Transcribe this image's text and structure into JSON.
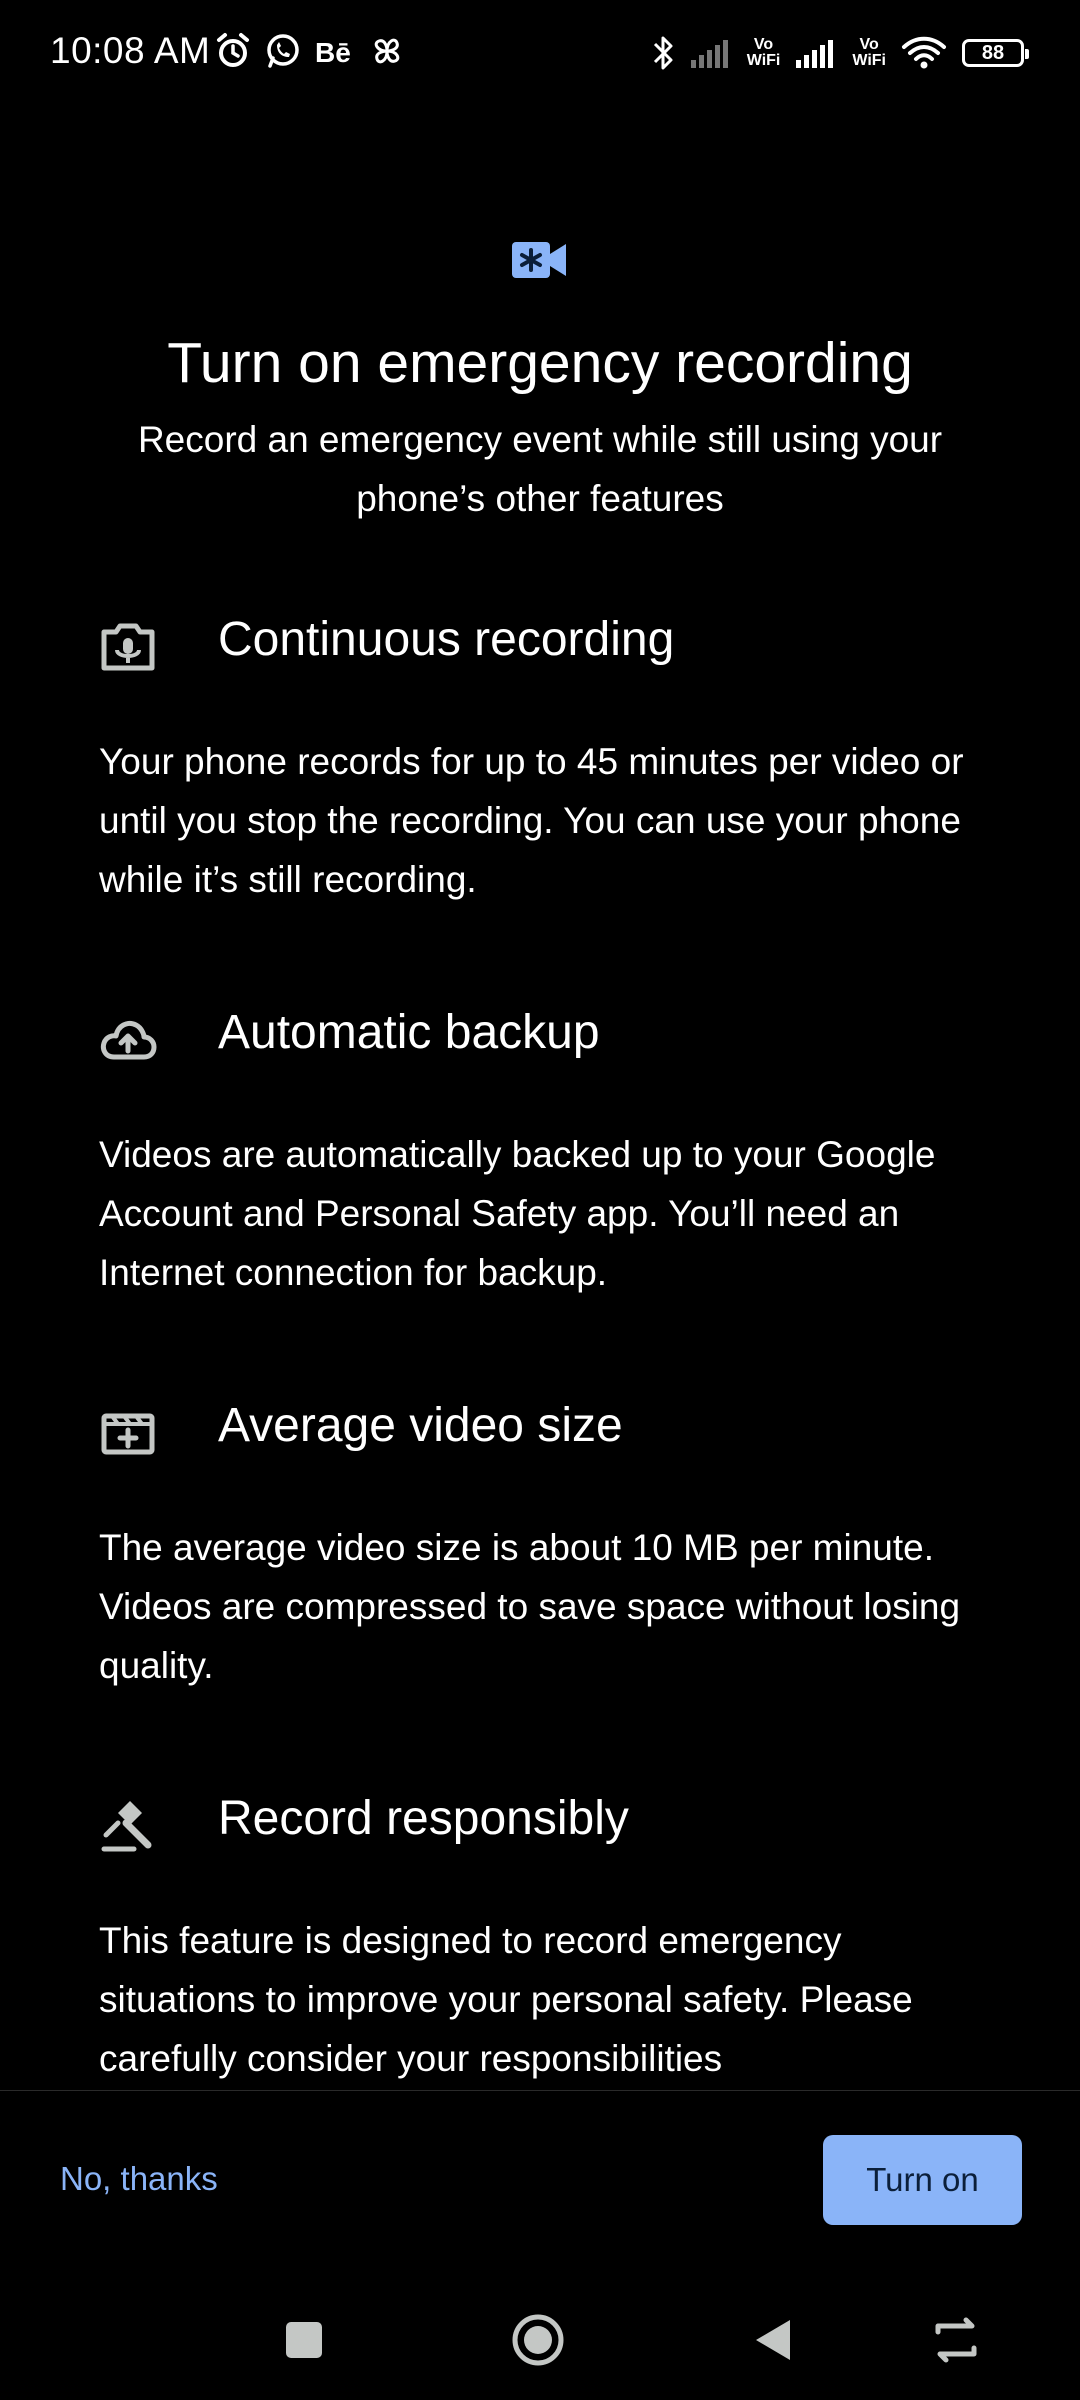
{
  "status_bar": {
    "time": "10:08 AM",
    "left_icons": [
      "alarm-icon",
      "whatsapp-icon",
      "behance-icon",
      "pinwheel-icon"
    ],
    "right_icons": [
      "bluetooth-icon",
      "signal-icon",
      "vowifi-icon",
      "signal-icon",
      "vowifi-icon",
      "wifi-icon",
      "battery-icon"
    ],
    "vowifi_label_1": "Vo\nWiFi",
    "vowifi_label_2": "Vo\nWiFi",
    "battery_level": "88"
  },
  "header": {
    "icon": "video-asterisk-icon",
    "title": "Turn on emergency recording",
    "subtitle": "Record an emergency event while still using your phone’s other features"
  },
  "sections": [
    {
      "icon": "camera-mic-icon",
      "title": "Continuous recording",
      "body": "Your phone records for up to 45 minutes per video or until you stop the recording. You can use your phone while it’s still recording."
    },
    {
      "icon": "cloud-upload-icon",
      "title": "Automatic backup",
      "body": "Videos are automatically backed up to your Google Account and Personal Safety app. You’ll need an Internet connection for backup."
    },
    {
      "icon": "video-storage-icon",
      "title": "Average video size",
      "body": "The average video size is about 10 MB per minute. Videos are compressed to save space without losing quality."
    },
    {
      "icon": "gavel-icon",
      "title": "Record responsibly",
      "body": "This feature is designed to record emergency situations to improve your personal safety. Please carefully consider your responsibilities"
    }
  ],
  "actions": {
    "decline_label": "No, thanks",
    "accept_label": "Turn on"
  },
  "colors": {
    "background": "#000000",
    "accent": "#8ab4f8",
    "text": "#ffffff",
    "icon_gray": "#c4c7c5"
  }
}
